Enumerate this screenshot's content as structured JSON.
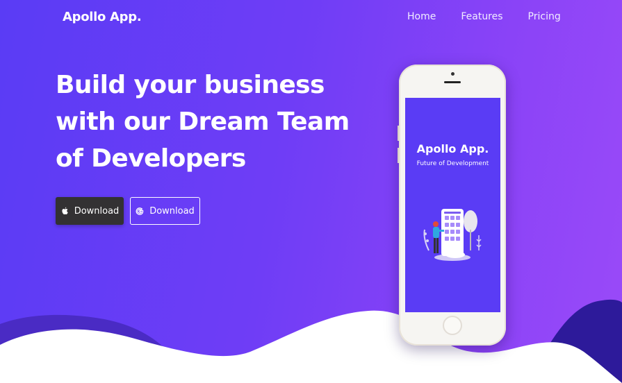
{
  "brand": {
    "name": "Apollo App."
  },
  "nav": {
    "items": [
      {
        "label": "Home"
      },
      {
        "label": "Features"
      },
      {
        "label": "Pricing"
      }
    ]
  },
  "hero": {
    "headline_lines": [
      "Build your business",
      "with our Dream Team",
      "of Developers"
    ],
    "buttons": {
      "apple": {
        "label": "Download",
        "icon": "apple-icon"
      },
      "google": {
        "label": "Download",
        "icon": "google-icon"
      }
    }
  },
  "phone": {
    "screen_title": "Apollo App.",
    "screen_subtitle": "Future of Development"
  },
  "colors": {
    "primary": "#5a3cf5",
    "accent": "#9a4af8",
    "dark_button": "#333133",
    "wave_dark": "#2d1a9a"
  }
}
